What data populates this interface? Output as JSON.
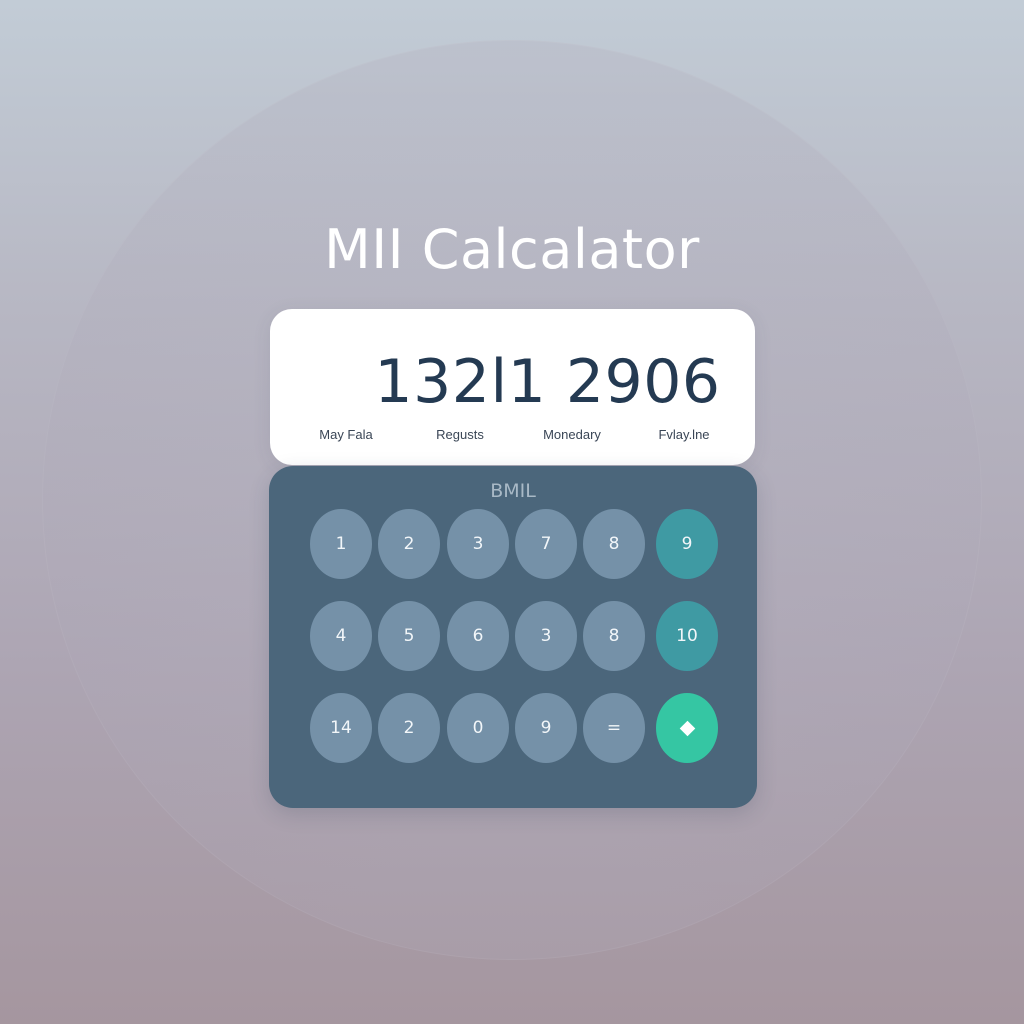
{
  "app": {
    "title": "MII Calcalator"
  },
  "display": {
    "value": "132l1 2906",
    "labels": [
      "May Fala",
      "Regusts",
      "Monedary",
      "Fvlay.lne"
    ]
  },
  "keypad": {
    "label": "BMIL",
    "rows": [
      [
        "1",
        "2",
        "3",
        "7",
        "8",
        "9"
      ],
      [
        "4",
        "5",
        "6",
        "3",
        "8",
        "10"
      ],
      [
        "14",
        "2",
        "0",
        "9",
        "=",
        ""
      ]
    ],
    "action_icon": "diamond-icon"
  },
  "colors": {
    "display_text": "#243a52",
    "keypad_bg": "#4b667b",
    "key_bg": "#7591a8",
    "key_teal": "#3f9aa3",
    "key_action": "#35c6a3"
  }
}
